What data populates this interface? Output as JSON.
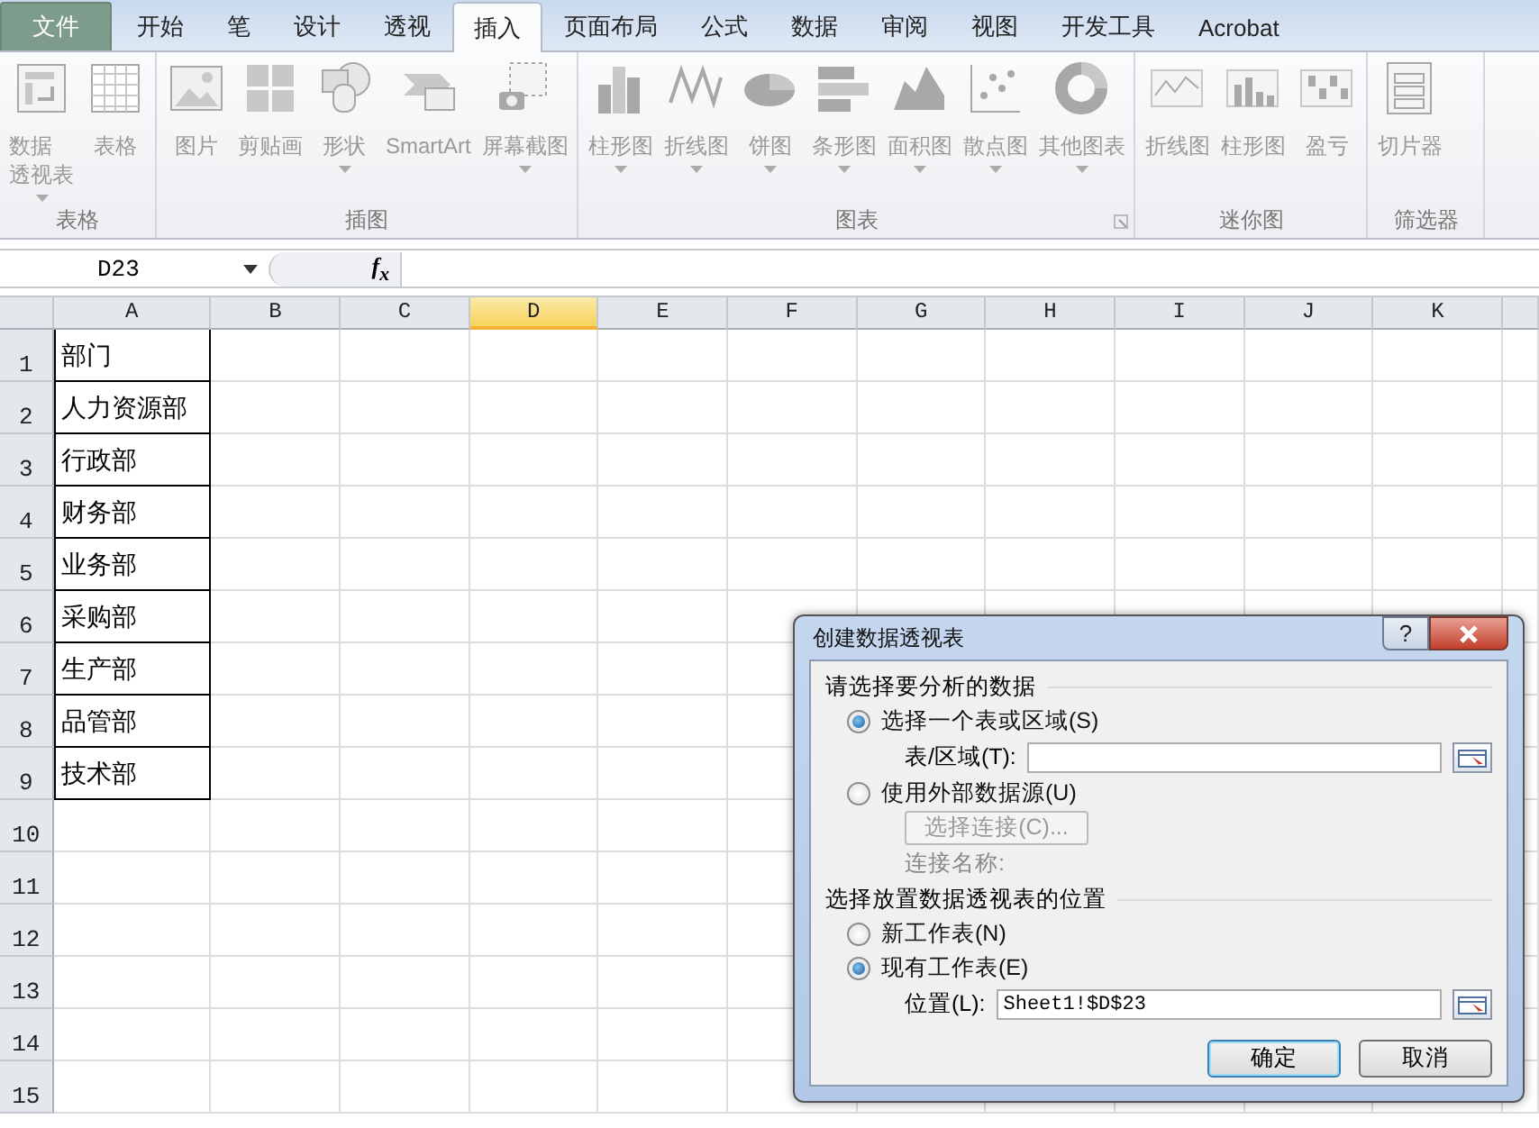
{
  "file_tab": "文件",
  "tabs": [
    {
      "label": "开始",
      "selected": false
    },
    {
      "label": "笔",
      "selected": false
    },
    {
      "label": "设计",
      "selected": false
    },
    {
      "label": "透视",
      "selected": false
    },
    {
      "label": "插入",
      "selected": true
    },
    {
      "label": "页面布局",
      "selected": false
    },
    {
      "label": "公式",
      "selected": false
    },
    {
      "label": "数据",
      "selected": false
    },
    {
      "label": "审阅",
      "selected": false
    },
    {
      "label": "视图",
      "selected": false
    },
    {
      "label": "开发工具",
      "selected": false
    },
    {
      "label": "Acrobat",
      "selected": false
    }
  ],
  "ribbon": {
    "disabled": true,
    "groups": [
      {
        "label": "表格",
        "items": [
          {
            "kind": "pivot",
            "label": "数据",
            "label2": "透视表",
            "dropdown": true
          },
          {
            "kind": "table",
            "label": "表格"
          }
        ]
      },
      {
        "label": "插图",
        "items": [
          {
            "kind": "picture",
            "label": "图片"
          },
          {
            "kind": "clipart",
            "label": "剪贴画"
          },
          {
            "kind": "shapes",
            "label": "形状",
            "dropdown": true
          },
          {
            "kind": "smartart",
            "label": "SmartArt"
          },
          {
            "kind": "screenshot",
            "label": "屏幕截图",
            "dropdown": true
          }
        ]
      },
      {
        "label": "图表",
        "launcher": true,
        "items": [
          {
            "kind": "column",
            "label": "柱形图",
            "dropdown": true
          },
          {
            "kind": "line",
            "label": "折线图",
            "dropdown": true
          },
          {
            "kind": "pie",
            "label": "饼图",
            "dropdown": true
          },
          {
            "kind": "bar",
            "label": "条形图",
            "dropdown": true
          },
          {
            "kind": "area",
            "label": "面积图",
            "dropdown": true
          },
          {
            "kind": "scatter",
            "label": "散点图",
            "dropdown": true
          },
          {
            "kind": "donut",
            "label": "其他图表",
            "dropdown": true
          }
        ]
      },
      {
        "label": "迷你图",
        "items": [
          {
            "kind": "sparkline",
            "label": "折线图"
          },
          {
            "kind": "sparkcolumn",
            "label": "柱形图"
          },
          {
            "kind": "winloss",
            "label": "盈亏"
          }
        ]
      },
      {
        "label": "筛选器",
        "items": [
          {
            "kind": "slicer",
            "label": "切片器"
          }
        ]
      }
    ]
  },
  "name_box": "D23",
  "function_label": "f$_{x}$",
  "columns": [
    {
      "label": "A",
      "selected": false
    },
    {
      "label": "B",
      "selected": false
    },
    {
      "label": "C",
      "selected": false
    },
    {
      "label": "D",
      "selected": true
    },
    {
      "label": "E",
      "selected": false
    },
    {
      "label": "F",
      "selected": false
    },
    {
      "label": "G",
      "selected": false
    },
    {
      "label": "H",
      "selected": false
    },
    {
      "label": "I",
      "selected": false
    },
    {
      "label": "J",
      "selected": false
    },
    {
      "label": "K",
      "selected": false
    }
  ],
  "rows": [
    {
      "label": "1",
      "value": "部门"
    },
    {
      "label": "2",
      "value": "人力资源部"
    },
    {
      "label": "3",
      "value": "行政部"
    },
    {
      "label": "4",
      "value": "财务部"
    },
    {
      "label": "5",
      "value": "业务部"
    },
    {
      "label": "6",
      "value": "采购部"
    },
    {
      "label": "7",
      "value": "生产部"
    },
    {
      "label": "8",
      "value": "品管部"
    },
    {
      "label": "9",
      "value": "技术部"
    },
    {
      "label": "10"
    },
    {
      "label": "11"
    },
    {
      "label": "12"
    },
    {
      "label": "13"
    },
    {
      "label": "14"
    },
    {
      "label": "15"
    }
  ],
  "dialog": {
    "title": "创建数据透视表",
    "help": "?",
    "section1": {
      "heading": "请选择要分析的数据",
      "option_table": {
        "label": "选择一个表或区域(S)",
        "selected": true
      },
      "range_label": "表/区域(T):",
      "option_external": {
        "label": "使用外部数据源(U)",
        "selected": false
      },
      "connect_button": {
        "label": "选择连接(C)...",
        "disabled": true
      },
      "connection_label": "连接名称:"
    },
    "section2": {
      "heading": "选择放置数据透视表的位置",
      "option_new": {
        "label": "新工作表(N)",
        "selected": false
      },
      "option_existing": {
        "label": "现有工作表(E)",
        "selected": true
      },
      "location_label": "位置(L):",
      "location_value": "Sheet1!$D$23"
    },
    "buttons": [
      {
        "label": "确定",
        "default": true
      },
      {
        "label": "取消",
        "default": false
      }
    ]
  }
}
